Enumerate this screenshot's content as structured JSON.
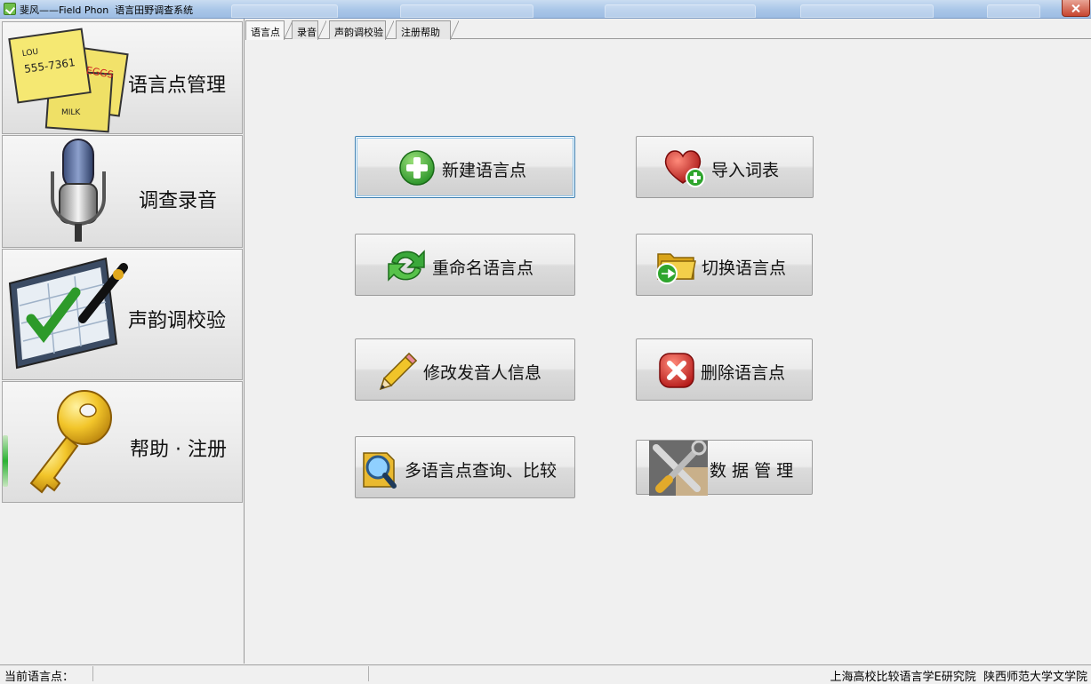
{
  "window": {
    "title": "斐风——Field Phon  语言田野调查系统"
  },
  "nav": {
    "items": [
      {
        "label": "语言点管理",
        "icon": "sticky-notes-icon"
      },
      {
        "label": "调查录音",
        "icon": "microphone-icon"
      },
      {
        "label": "声韵调校验",
        "icon": "checklist-pen-icon"
      },
      {
        "label": "帮助 · 注册",
        "icon": "key-icon"
      }
    ]
  },
  "tabs": [
    {
      "label": "语言点",
      "active": true
    },
    {
      "label": "录音"
    },
    {
      "label": "声韵调校验"
    },
    {
      "label": "注册帮助"
    }
  ],
  "actions": {
    "new_point": {
      "label": "新建语言点",
      "icon": "green-plus-icon"
    },
    "import_wordlist": {
      "label": "导入词表",
      "icon": "red-heart-add-icon"
    },
    "rename_point": {
      "label": "重命名语言点",
      "icon": "green-refresh-icon"
    },
    "switch_point": {
      "label": "切换语言点",
      "icon": "folder-arrow-icon"
    },
    "edit_speaker": {
      "label": "修改发音人信息",
      "icon": "pencil-icon"
    },
    "delete_point": {
      "label": "删除语言点",
      "icon": "red-x-icon"
    },
    "query_compare": {
      "label": "多语言点查询、比较",
      "icon": "magnifier-icon"
    },
    "data_manage": {
      "label": "数 据 管 理",
      "icon": "tools-icon"
    }
  },
  "status": {
    "current_point_label": "当前语言点：",
    "current_point_value": "",
    "org_text": "上海高校比较语言学E研究院  陕西师范大学文学院"
  },
  "colors": {
    "focus_border": "#3c7fb1",
    "green": "#2fa52d",
    "red": "#d3241f",
    "gold": "#e8b417"
  }
}
